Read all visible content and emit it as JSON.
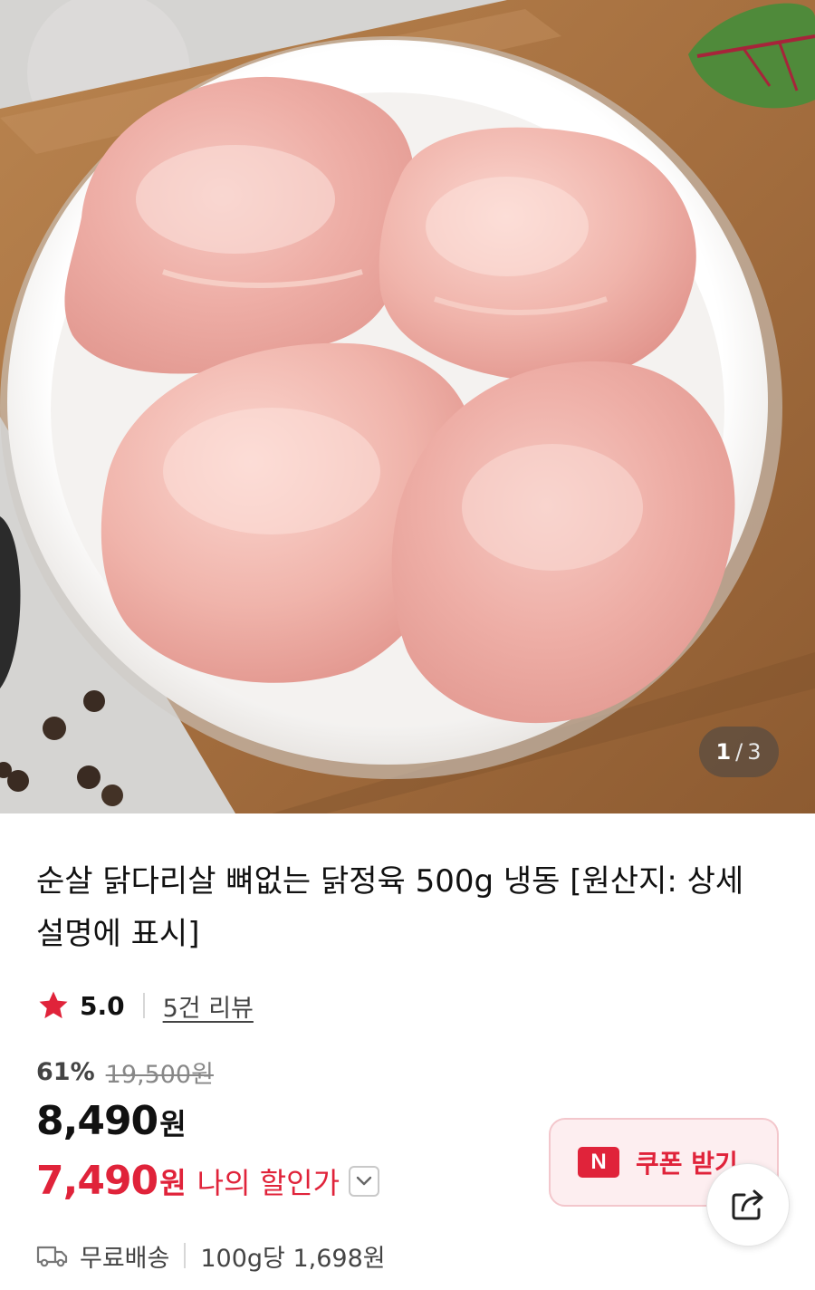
{
  "gallery": {
    "current": "1",
    "separator": "/",
    "total": "3"
  },
  "product": {
    "title": "순살 닭다리살 뼈없는 닭정육 500g 냉동 [원산지: 상세설명에 표시]"
  },
  "rating": {
    "value": "5.0",
    "review_link": "5건 리뷰",
    "star_color": "#e0233a"
  },
  "price": {
    "discount_rate": "61%",
    "original_price": "19,500원",
    "sale_price": "8,490",
    "sale_unit": "원",
    "my_price": "7,490",
    "my_unit": "원",
    "my_price_label": "나의 할인가",
    "accent_color": "#e0233a"
  },
  "coupon": {
    "badge": "N",
    "label": "쿠폰 받기"
  },
  "share": {
    "icon": "share-icon"
  },
  "shipping": {
    "icon": "truck-icon",
    "label": "무료배송",
    "unit_price": "100g당 1,698원"
  }
}
